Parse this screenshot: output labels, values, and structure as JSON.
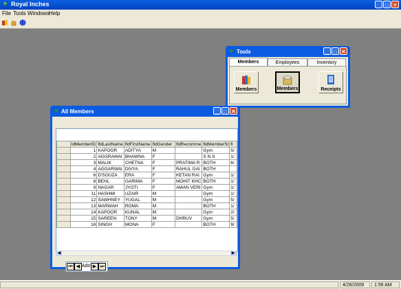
{
  "app": {
    "title": "Royal Inches"
  },
  "menu": {
    "file": "File",
    "tools": "Tools",
    "windows": "Windows",
    "help": "Help"
  },
  "status": {
    "date": "4/28/2009",
    "time": "1:56 AM"
  },
  "tools_window": {
    "title": "Tools",
    "tabs": [
      "Members",
      "Employees",
      "Inventory"
    ],
    "buttons": [
      "Members",
      "Members",
      "Receipts"
    ]
  },
  "members_window": {
    "title": "All Members",
    "columns": [
      "ldMemberID",
      "fldLastName",
      "fldFirstName",
      "fldGender",
      "fldRecomme",
      "fldMemberSt",
      "fl"
    ],
    "rows": [
      [
        "1",
        "KAPOOR",
        "ADITYA",
        "M",
        "",
        "Gym",
        "5/"
      ],
      [
        "2",
        "AGGRAWAI",
        "BHAWNA",
        "F",
        "",
        "S N S",
        "1/"
      ],
      [
        "3",
        "MALIK",
        "CHETNA",
        "F",
        "PRATIMA R",
        "BOTH",
        "6/"
      ],
      [
        "4",
        "AGGARWAI",
        "DIVYA",
        "F",
        "RAHUL GAI",
        "BOTH",
        ""
      ],
      [
        "6",
        "D'SOUZA",
        "ERA",
        "F",
        "KETAN RAI",
        "Gym",
        "1/"
      ],
      [
        "8",
        "BEHL",
        "GARIMA",
        "F",
        "MOHIT KHC",
        "BOTH",
        "1/"
      ],
      [
        "9",
        "NAGAR",
        "JYOTI",
        "F",
        "AMAN VERI",
        "Gym",
        "1/"
      ],
      [
        "11",
        "HASHMI",
        "UZAIR",
        "M",
        "",
        "Gym",
        "1/"
      ],
      [
        "12",
        "SAWHNEY",
        "YUGAL",
        "M",
        "",
        "Gym",
        "5/"
      ],
      [
        "13",
        "MARWAH",
        "ROMA",
        "M",
        "",
        "BOTH",
        "1/"
      ],
      [
        "14",
        "KAPOOR",
        "KUNAL",
        "M",
        "",
        "Gym",
        "2/"
      ],
      [
        "15",
        "SAREEN",
        "TONY",
        "M",
        "DHRUV",
        "Gym",
        "5/"
      ],
      [
        "16",
        "SINGH",
        "MONA",
        "F",
        "",
        "BOTH",
        "9/"
      ]
    ],
    "nav_text": "Ado"
  }
}
